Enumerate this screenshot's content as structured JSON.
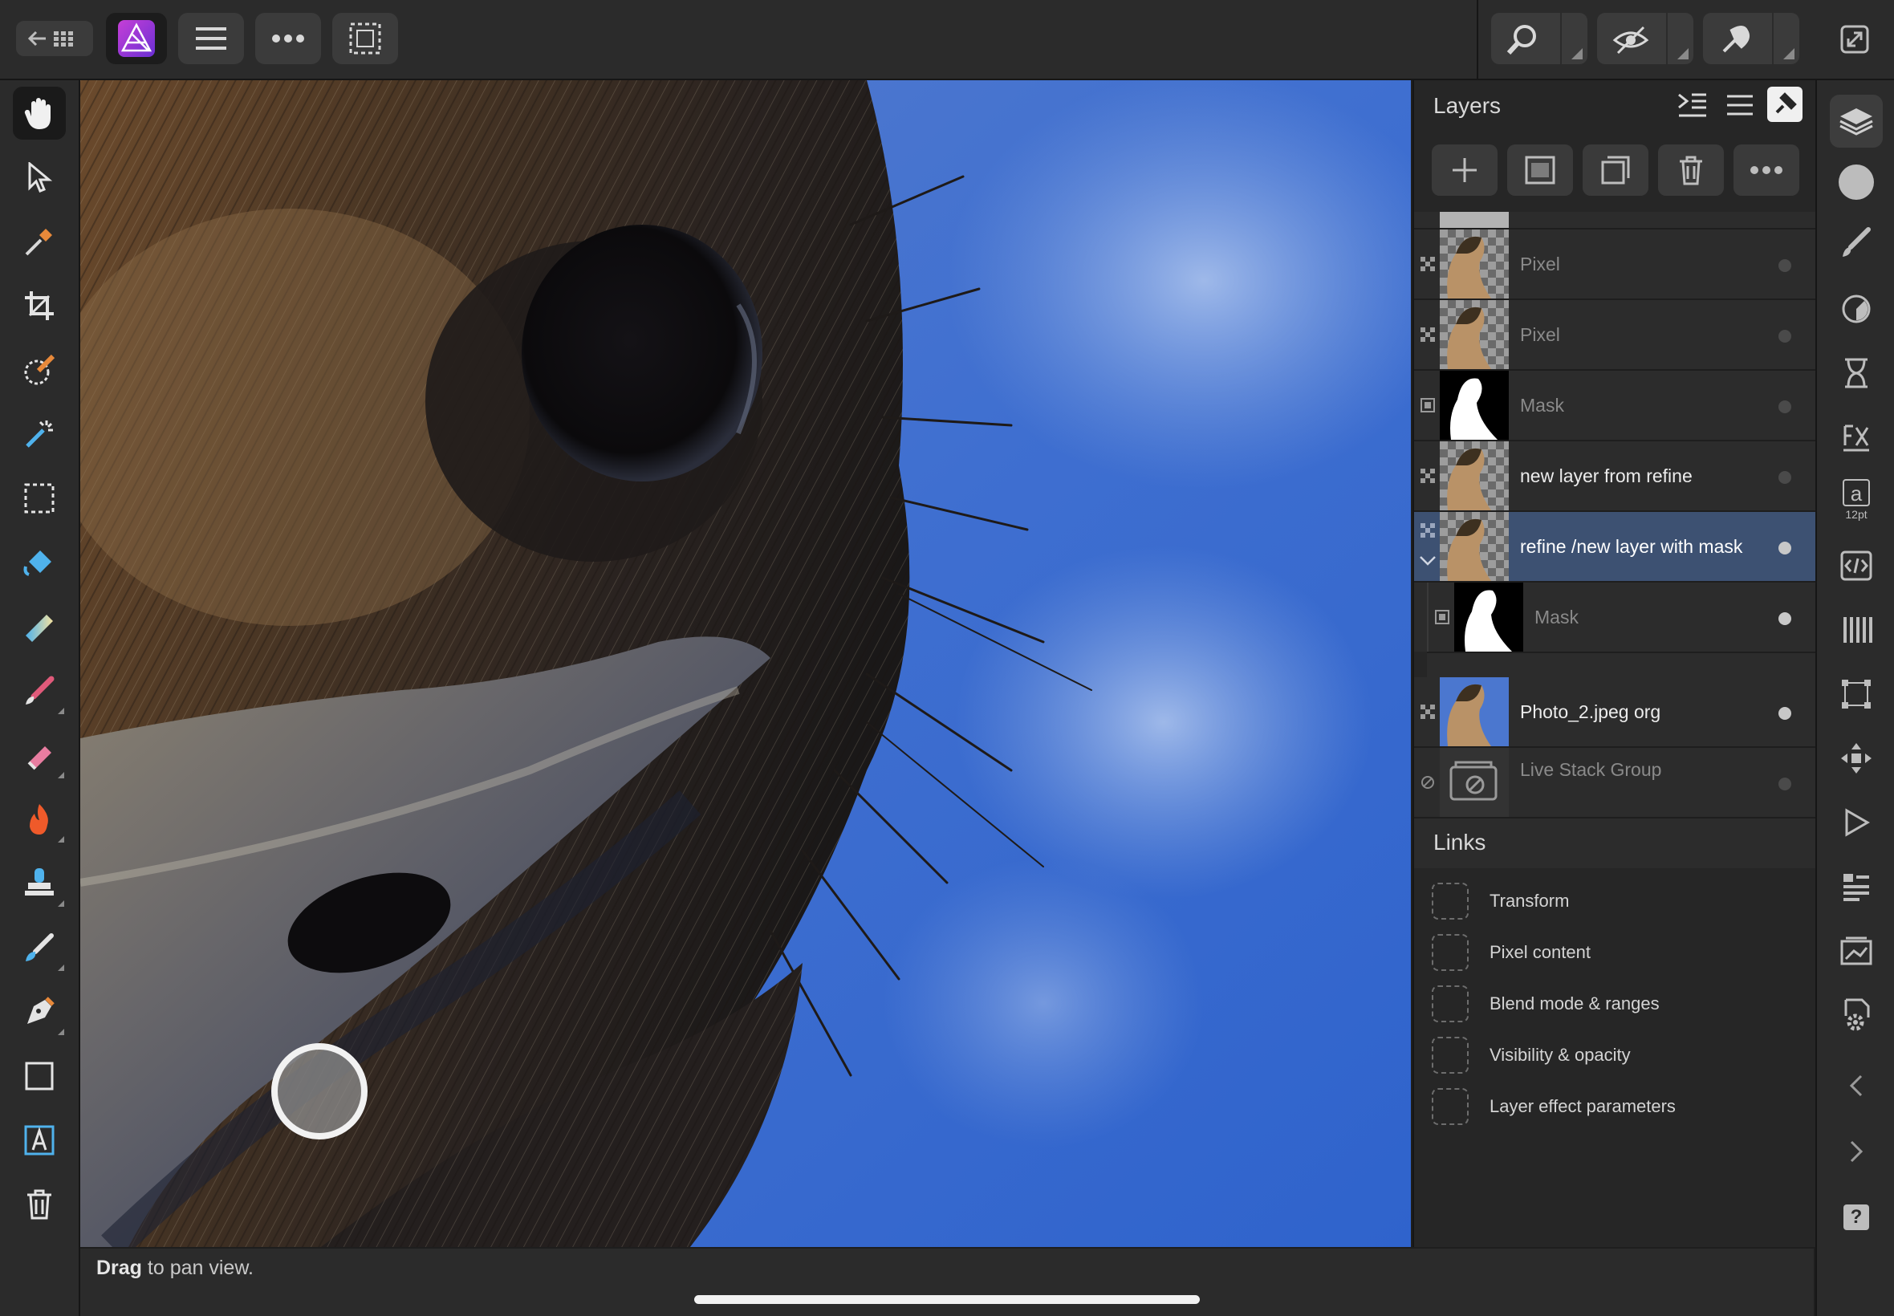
{
  "top_bar": {
    "back_label": "←",
    "app_icon": "affinity-photo-icon",
    "buttons": [
      "menu-icon",
      "more-icon",
      "selection-icon"
    ],
    "right_groups": [
      "zoom-icon",
      "view-icon",
      "assistant-icon"
    ],
    "fullscreen_icon": "fullscreen-icon"
  },
  "left_tools": [
    "hand-icon",
    "move-icon",
    "color-picker-icon",
    "crop-icon",
    "selection-brush-icon",
    "magic-wand-icon",
    "marquee-icon",
    "flood-fill-icon",
    "gradient-icon",
    "paint-brush-icon",
    "erase-brush-icon",
    "dodge-burn-icon",
    "clone-stamp-icon",
    "healing-brush-icon",
    "pen-icon",
    "rectangle-icon",
    "text-icon",
    "trash-icon"
  ],
  "status": {
    "bold": "Drag",
    "text": " to pan view."
  },
  "layers_panel": {
    "title": "Layers",
    "actions": [
      "add-layer-icon",
      "mask-icon",
      "duplicate-icon",
      "delete-icon",
      "more-icon"
    ],
    "layers": [
      {
        "name": "Pixel",
        "kind": "pixel",
        "dim": true,
        "selected": false
      },
      {
        "name": "Pixel",
        "kind": "pixel",
        "dim": true,
        "selected": false
      },
      {
        "name": "Mask",
        "kind": "mask",
        "dim": true,
        "selected": false
      },
      {
        "name": "new layer from refine",
        "kind": "pixel",
        "dim": false,
        "selected": false
      },
      {
        "name": "refine /new layer with mask",
        "kind": "pixel",
        "dim": false,
        "selected": true
      },
      {
        "name": "Mask",
        "kind": "mask",
        "dim": true,
        "selected": false,
        "child": true
      },
      {
        "name": "Photo_2.jpeg org",
        "kind": "photo",
        "dim": false,
        "selected": false
      },
      {
        "name": "Live Stack Group",
        "kind": "livestack",
        "dim": true,
        "selected": false
      }
    ],
    "links_title": "Links",
    "links": [
      "Transform",
      "Pixel content",
      "Blend mode & ranges",
      "Visibility & opacity",
      "Layer effect parameters"
    ]
  },
  "right_strip": {
    "items": [
      "layers-icon",
      "color-icon",
      "brushes-icon",
      "adjustments-icon",
      "history-icon",
      "fx-icon",
      "character-icon",
      "code-icon",
      "channels-icon",
      "transform-icon",
      "navigator-icon",
      "macro-icon",
      "stock-icon",
      "library-icon",
      "settings-icon",
      "chevron-left-icon",
      "chevron-right-icon",
      "help-icon"
    ],
    "character_label": "a",
    "character_size": "12pt",
    "help_label": "?"
  }
}
